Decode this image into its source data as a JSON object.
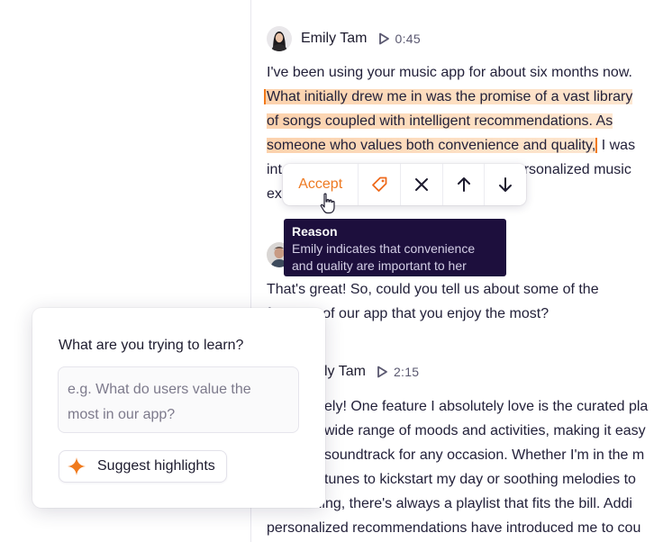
{
  "transcript": {
    "block1": {
      "speaker": "Emily Tam",
      "duration": "0:45",
      "line1": "I've been using your music app for about six months now.",
      "line2": "What initially drew me in was the promise of a vast library",
      "line3": "of songs coupled with intelligent recommendations. As",
      "line4_hl": "someone who values both convenience and quality,",
      "line4_rest": " I was",
      "line5_start": "int",
      "line5_end": "personalized music",
      "line6": "ex"
    },
    "block2": {
      "line1": "That's great! So, could you tell us about some of the",
      "line2": "features of our app that you enjoy the most?"
    },
    "block3": {
      "speaker": "ly Tam",
      "duration": "2:15",
      "lines": [
        "ely! One feature I absolutely love is the curated pla",
        "wide range of moods and activities, making it easy",
        "soundtrack for any occasion. Whether I'm in the m",
        "tunes to kickstart my day or soothing melodies to",
        "the evening, there's always a playlist that fits the bill. Addi",
        "personalized recommendations have introduced me to cou"
      ]
    }
  },
  "toolbar": {
    "accept_label": "Accept",
    "icons": [
      "tag-icon",
      "close-icon",
      "arrow-up-icon",
      "arrow-down-icon"
    ]
  },
  "tooltip": {
    "title": "Reason",
    "body_line1": "Emily indicates that convenience",
    "body_line2": "and quality are important to her"
  },
  "panel": {
    "question": "What are you trying to learn?",
    "placeholder_line1": "e.g. What do users value the",
    "placeholder_line2": "most in our app?",
    "suggest_label": "Suggest highlights"
  },
  "colors": {
    "accent": "#ee7a22",
    "highlight": "#fcd2ad",
    "tooltip_bg": "#1d0f3d",
    "text": "#23213a"
  }
}
